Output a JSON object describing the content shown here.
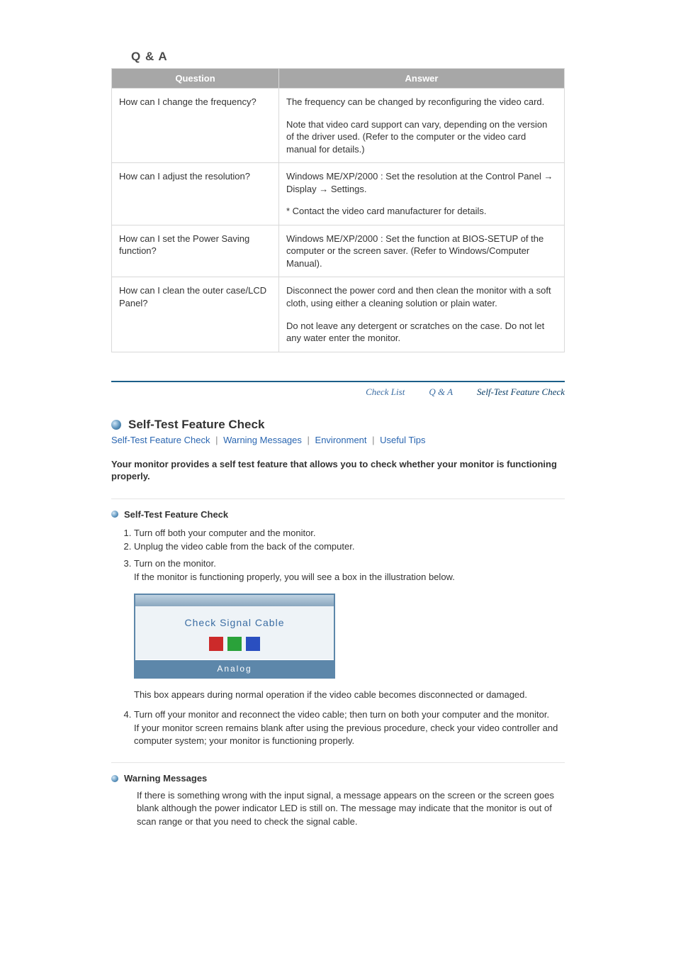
{
  "qa": {
    "title": "Q & A",
    "head_q": "Question",
    "head_a": "Answer",
    "rows": [
      {
        "q": "How can I change the frequency?",
        "a1": "The frequency can be changed by reconfiguring the video card.",
        "a2": "Note that video card support can vary, depending on the version of the driver used. (Refer to the computer or the video card manual for details.)"
      },
      {
        "q": "How can I adjust the resolution?",
        "a1": "Windows ME/XP/2000 : Set the resolution at the Control Panel → Display → Settings.",
        "a2": "* Contact the video card manufacturer for details."
      },
      {
        "q": "How can I set the Power Saving function?",
        "a1": "Windows ME/XP/2000 : Set the function at BIOS-SETUP of the computer or the screen saver. (Refer to Windows/Computer Manual).",
        "a2": ""
      },
      {
        "q": "How can I clean the outer case/LCD Panel?",
        "a1": "Disconnect the power cord and then clean the monitor with a soft cloth, using either a cleaning solution or plain water.",
        "a2": "Do not leave any detergent or scratches on the case. Do not let any water enter the monitor."
      }
    ]
  },
  "tabs": {
    "t1": "Check List",
    "t2": "Q & A",
    "t3": "Self-Test Feature Check"
  },
  "selftest": {
    "heading": "Self-Test Feature Check",
    "links": {
      "l1": "Self-Test Feature Check",
      "l2": "Warning Messages",
      "l3": "Environment",
      "l4": "Useful Tips"
    },
    "intro": "Your monitor provides a self test feature that allows you to check whether your monitor is functioning properly.",
    "sub1_title": "Self-Test Feature Check",
    "steps": {
      "s1": "Turn off both your computer and the monitor.",
      "s2": "Unplug the video cable from the back of the computer.",
      "s3a": "Turn on the monitor.",
      "s3b": "If the monitor is functioning properly, you will see a box in the illustration below.",
      "box_text": "Check Signal Cable",
      "box_bottom": "Analog",
      "s3c": "This box appears during normal operation if the video cable becomes disconnected or damaged.",
      "s4a": "Turn off your monitor and reconnect the video cable; then turn on both your computer and the monitor.",
      "s4b": "If your monitor screen remains blank after using the previous procedure, check your video controller and computer system; your monitor is functioning properly."
    },
    "sub2_title": "Warning Messages",
    "warn_para": "If there is something wrong with the input signal, a message appears on the screen or the screen goes blank although the power indicator LED is still on. The message may indicate that the monitor is out of scan range or that you need to check the signal cable."
  }
}
